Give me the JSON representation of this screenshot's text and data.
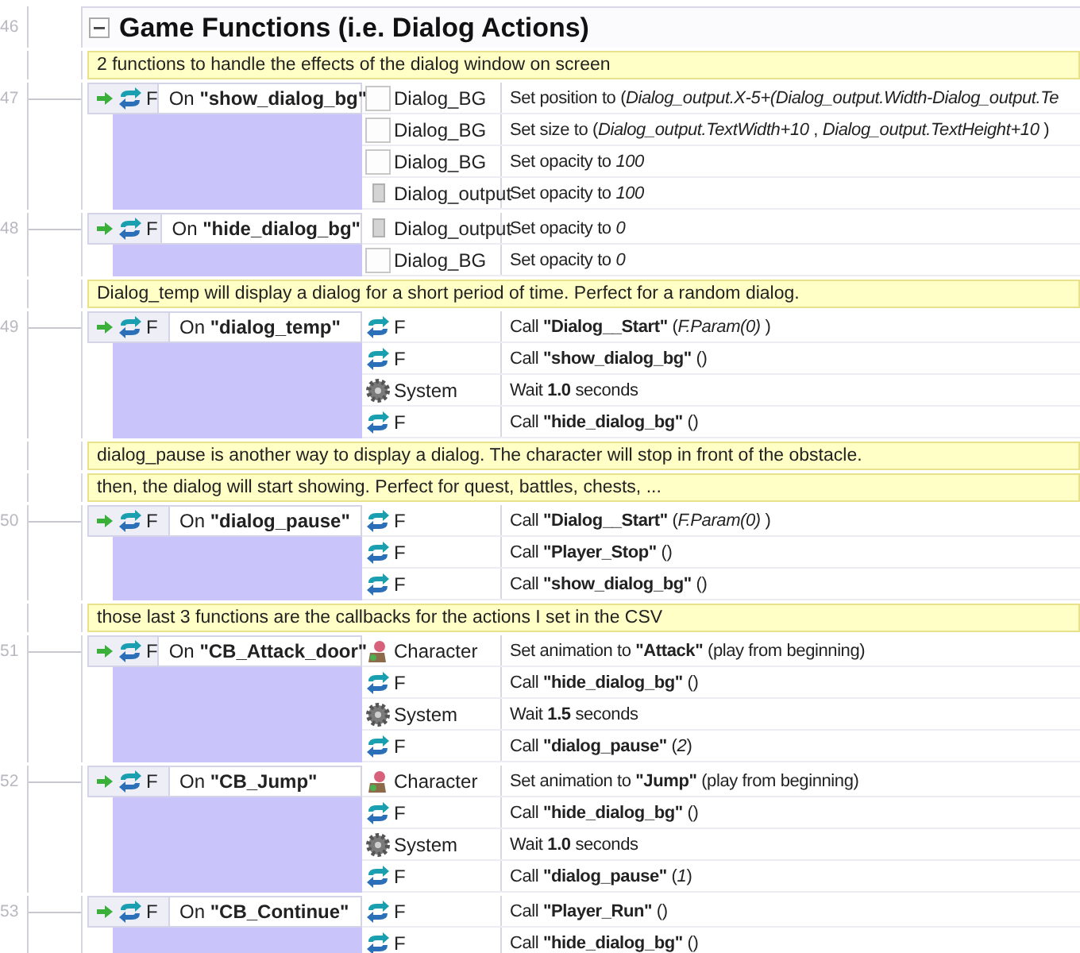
{
  "group": {
    "line_number": "46",
    "title": "Game Functions (i.e. Dialog Actions)",
    "expanded": true
  },
  "items": [
    {
      "kind": "comment",
      "lines": [
        "2 functions to handle the effects of the dialog window on screen"
      ]
    },
    {
      "kind": "event",
      "line_number": "47",
      "condition": {
        "object": "F",
        "text": "On **\"show_dialog_bg\"**"
      },
      "actions": [
        {
          "kind": "sprite",
          "object": "Dialog_BG",
          "text": "Set position to (*Dialog_output.X-5+(Dialog_output.Width-Dialog_output.Te*"
        },
        {
          "kind": "sprite",
          "object": "Dialog_BG",
          "text": "Set size to (*Dialog_output.TextWidth+10* , *Dialog_output.TextHeight+10* )"
        },
        {
          "kind": "sprite",
          "object": "Dialog_BG",
          "text": "Set opacity to *100*"
        },
        {
          "kind": "text",
          "object": "Dialog_output",
          "text": "Set opacity to *100*"
        }
      ]
    },
    {
      "kind": "event",
      "line_number": "48",
      "condition": {
        "object": "F",
        "text": "On **\"hide_dialog_bg\"**"
      },
      "actions": [
        {
          "kind": "text",
          "object": "Dialog_output",
          "text": "Set opacity to *0*"
        },
        {
          "kind": "sprite",
          "object": "Dialog_BG",
          "text": "Set opacity to *0*"
        }
      ]
    },
    {
      "kind": "comment",
      "lines": [
        "Dialog_temp will display a dialog for a short period of time. Perfect for a random dialog."
      ]
    },
    {
      "kind": "event",
      "line_number": "49",
      "condition": {
        "object": "F",
        "text": "On **\"dialog_temp\"**"
      },
      "actions": [
        {
          "kind": "function",
          "object": "F",
          "text": "Call **\"Dialog__Start\"** (*F.Param(0)* )"
        },
        {
          "kind": "function",
          "object": "F",
          "text": "Call **\"show_dialog_bg\"** ()"
        },
        {
          "kind": "system",
          "object": "System",
          "text": "Wait **1.0** seconds"
        },
        {
          "kind": "function",
          "object": "F",
          "text": "Call **\"hide_dialog_bg\"** ()"
        }
      ]
    },
    {
      "kind": "comment",
      "lines": [
        "dialog_pause is another way to display a dialog. The character will stop in front of the obstacle.",
        "then, the dialog will start showing. Perfect for quest, battles, chests, ..."
      ]
    },
    {
      "kind": "event",
      "line_number": "50",
      "condition": {
        "object": "F",
        "text": "On **\"dialog_pause\"**"
      },
      "actions": [
        {
          "kind": "function",
          "object": "F",
          "text": "Call **\"Dialog__Start\"** (*F.Param(0)* )"
        },
        {
          "kind": "function",
          "object": "F",
          "text": "Call **\"Player_Stop\"** ()"
        },
        {
          "kind": "function",
          "object": "F",
          "text": "Call **\"show_dialog_bg\"** ()"
        }
      ]
    },
    {
      "kind": "comment",
      "lines": [
        "those last 3 functions are the callbacks for the actions I set in the CSV"
      ]
    },
    {
      "kind": "event",
      "line_number": "51",
      "condition": {
        "object": "F",
        "text": "On **\"CB_Attack_door\"**"
      },
      "actions": [
        {
          "kind": "character",
          "object": "Character",
          "text": "Set animation to **\"Attack\"** (play from beginning)"
        },
        {
          "kind": "function",
          "object": "F",
          "text": "Call **\"hide_dialog_bg\"** ()"
        },
        {
          "kind": "system",
          "object": "System",
          "text": "Wait **1.5** seconds"
        },
        {
          "kind": "function",
          "object": "F",
          "text": "Call **\"dialog_pause\"** (*2*)"
        }
      ]
    },
    {
      "kind": "event",
      "line_number": "52",
      "condition": {
        "object": "F",
        "text": "On **\"CB_Jump\"**"
      },
      "actions": [
        {
          "kind": "character",
          "object": "Character",
          "text": "Set animation to **\"Jump\"** (play from beginning)"
        },
        {
          "kind": "function",
          "object": "F",
          "text": "Call **\"hide_dialog_bg\"** ()"
        },
        {
          "kind": "system",
          "object": "System",
          "text": "Wait **1.0** seconds"
        },
        {
          "kind": "function",
          "object": "F",
          "text": "Call **\"dialog_pause\"** (*1*)"
        }
      ]
    },
    {
      "kind": "event",
      "line_number": "53",
      "condition": {
        "object": "F",
        "text": "On **\"CB_Continue\"**"
      },
      "actions": [
        {
          "kind": "function",
          "object": "F",
          "text": "Call **\"Player_Run\"** ()"
        },
        {
          "kind": "function",
          "object": "F",
          "text": "Call **\"hide_dialog_bg\"** ()"
        }
      ]
    }
  ]
}
